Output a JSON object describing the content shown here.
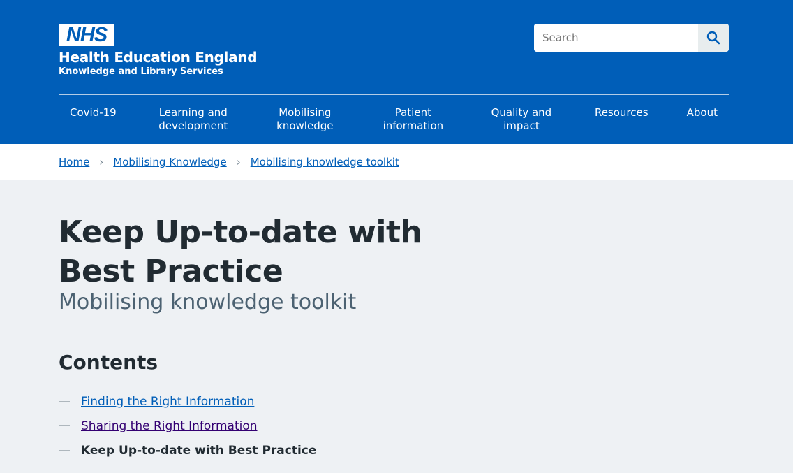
{
  "header": {
    "logo_text": "NHS",
    "org_name": "Health Education England",
    "org_sub": "Knowledge and Library Services",
    "search": {
      "placeholder": "Search",
      "icon": "search-icon"
    },
    "nav": [
      "Covid-19",
      "Learning and development",
      "Mobilising knowledge",
      "Patient information",
      "Quality and impact",
      "Resources",
      "About"
    ]
  },
  "breadcrumb": [
    "Home",
    "Mobilising Knowledge",
    "Mobilising knowledge toolkit"
  ],
  "main": {
    "title": "Keep Up-to-date with Best Practice",
    "caption": "Mobilising knowledge toolkit",
    "contents_heading": "Contents",
    "contents": [
      "Finding the Right Information",
      "Sharing the Right Information",
      "Keep Up-to-date with Best Practice"
    ]
  },
  "colors": {
    "brand": "#005eb8",
    "visited": "#330072",
    "text": "#212b32",
    "background": "#eef1f4"
  }
}
